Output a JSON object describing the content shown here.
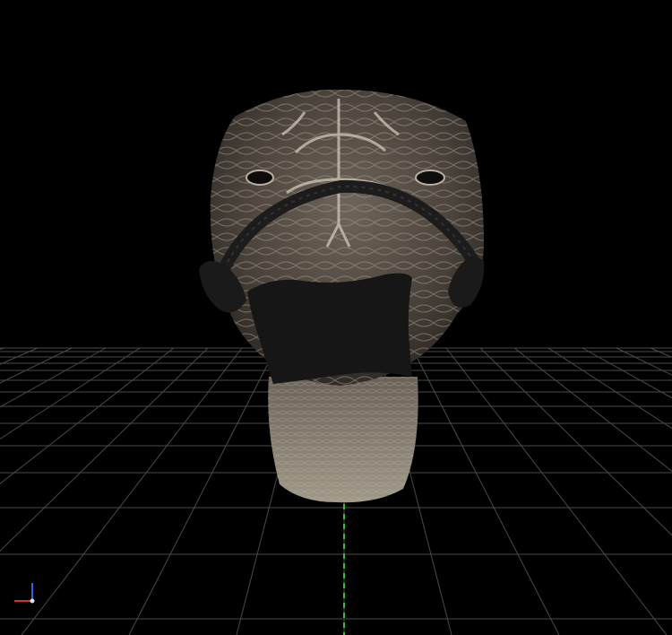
{
  "viewport": {
    "background_color": "#000000",
    "grid_color": "#4a4a4a",
    "axis_colors": {
      "x": "#d03030",
      "y": "#30c030",
      "z": "#3060e0"
    },
    "grid_visible": true,
    "axis_gizmo_visible": true
  },
  "model": {
    "icon": "lizard-head-model",
    "skin_color": "#5a5048",
    "skin_highlight_color": "#c8c0b0",
    "neck_color": "#8a8070",
    "gag_color": "#151515",
    "strap_color": "#1c1c1c"
  }
}
